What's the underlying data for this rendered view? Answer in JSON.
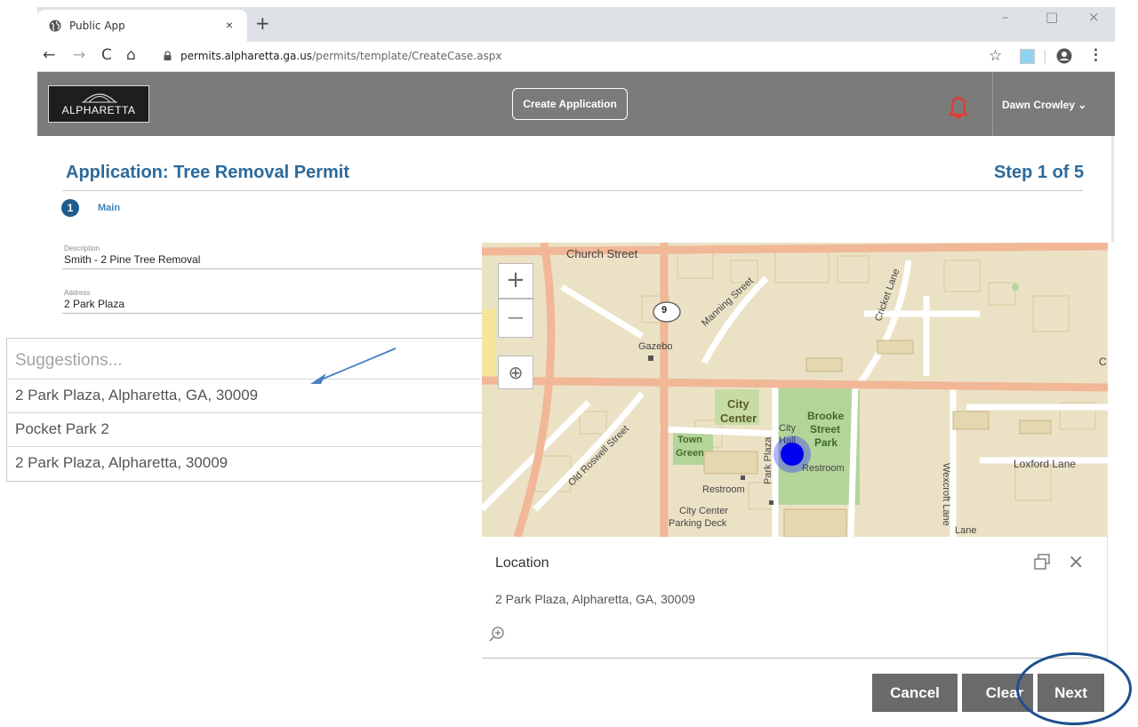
{
  "browser": {
    "tab_title": "Public App",
    "tab_close": "×",
    "new_tab": "+",
    "window_controls": [
      "–",
      "□",
      "×"
    ],
    "nav": {
      "back": "←",
      "forward": "→",
      "reload": "C",
      "home": "⌂"
    },
    "url_host": "permits.alpharetta.ga.us",
    "url_path": "/permits/template/CreateCase.aspx",
    "star": "☆",
    "menu": "⋮"
  },
  "header": {
    "logo_text": "ALPHARETTA",
    "create_button": "Create Application",
    "user_name": "Dawn Crowley",
    "user_chevron": "⌄",
    "colors": {
      "bar": "#7b7b7b",
      "bell": "#e53935"
    }
  },
  "page": {
    "title": "Application: Tree Removal Permit",
    "step_label": "Step 1 of 5",
    "step_number": "1",
    "step_name": "Main",
    "accent": "#2c6a9c"
  },
  "form": {
    "description_label": "Description",
    "description_value": "Smith - 2 Pine Tree Removal",
    "address_label": "Address",
    "address_value": "2 Park Plaza"
  },
  "suggestions": {
    "placeholder": "Suggestions...",
    "items": [
      "2 Park Plaza, Alpharetta, GA, 30009",
      "Pocket Park 2",
      "2 Park Plaza, Alpharetta, 30009"
    ]
  },
  "map": {
    "zoom_in": "+",
    "zoom_out": "—",
    "locate": "⊕",
    "route_shield": "9",
    "labels": {
      "church_street": "Church Street",
      "manning_street": "Manning Street",
      "cricket_lane": "Cricket Lane",
      "gazebo": "Gazebo",
      "city": "City",
      "center": "Center",
      "town": "Town",
      "green": "Green",
      "old_roswell": "Old Roswell Street",
      "brooke": "Brooke",
      "street": "Street",
      "park": "Park",
      "city_hall": "City Hall",
      "park_plaza": "Park Plaza",
      "restroom": "Restroom",
      "city_center_parking_1": "City Center",
      "city_center_parking_2": "Parking Deck",
      "loxford_lane": "Loxford Lane",
      "wexcroft_lane": "Wexcroft Lane",
      "lane": "Lane",
      "c": "C"
    }
  },
  "popup": {
    "title": "Location",
    "address": "2 Park Plaza, Alpharetta, GA, 30009",
    "close": "×"
  },
  "footer": {
    "cancel": "Cancel",
    "clear": "Clear",
    "next": "Next"
  }
}
